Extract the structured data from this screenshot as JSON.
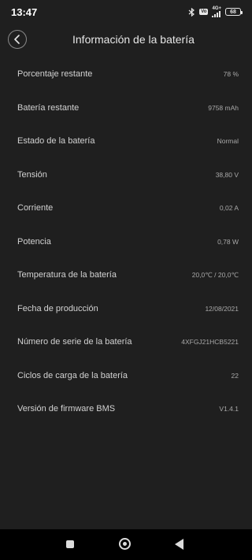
{
  "status_bar": {
    "time": "13:47",
    "volte_label": "Vo",
    "network_type": "4G+",
    "battery_level": "68"
  },
  "header": {
    "title": "Información de la batería",
    "back_icon": "chevron-left-icon"
  },
  "info": [
    {
      "label": "Porcentaje restante",
      "value": "78 %"
    },
    {
      "label": "Batería restante",
      "value": "9758 mAh"
    },
    {
      "label": "Estado de la batería",
      "value": "Normal"
    },
    {
      "label": "Tensión",
      "value": "38,80 V"
    },
    {
      "label": "Corriente",
      "value": "0,02 A"
    },
    {
      "label": "Potencia",
      "value": "0,78 W"
    },
    {
      "label": "Temperatura de la batería",
      "value": "20,0℃ / 20,0℃"
    },
    {
      "label": "Fecha de producción",
      "value": "12/08/2021"
    },
    {
      "label": "Número de serie de la batería",
      "value": "4XFGJ21HCB5221"
    },
    {
      "label": "Ciclos de carga de la batería",
      "value": "22"
    },
    {
      "label": "Versión de firmware BMS",
      "value": "V1.4.1"
    }
  ],
  "nav_bar": {
    "icons": [
      "recents-square-icon",
      "home-circle-icon",
      "back-triangle-icon"
    ]
  },
  "colors": {
    "background": "#1f1f1f",
    "nav_background": "#000000",
    "label_text": "#d2d2d2",
    "value_text": "#a8a8a8"
  }
}
